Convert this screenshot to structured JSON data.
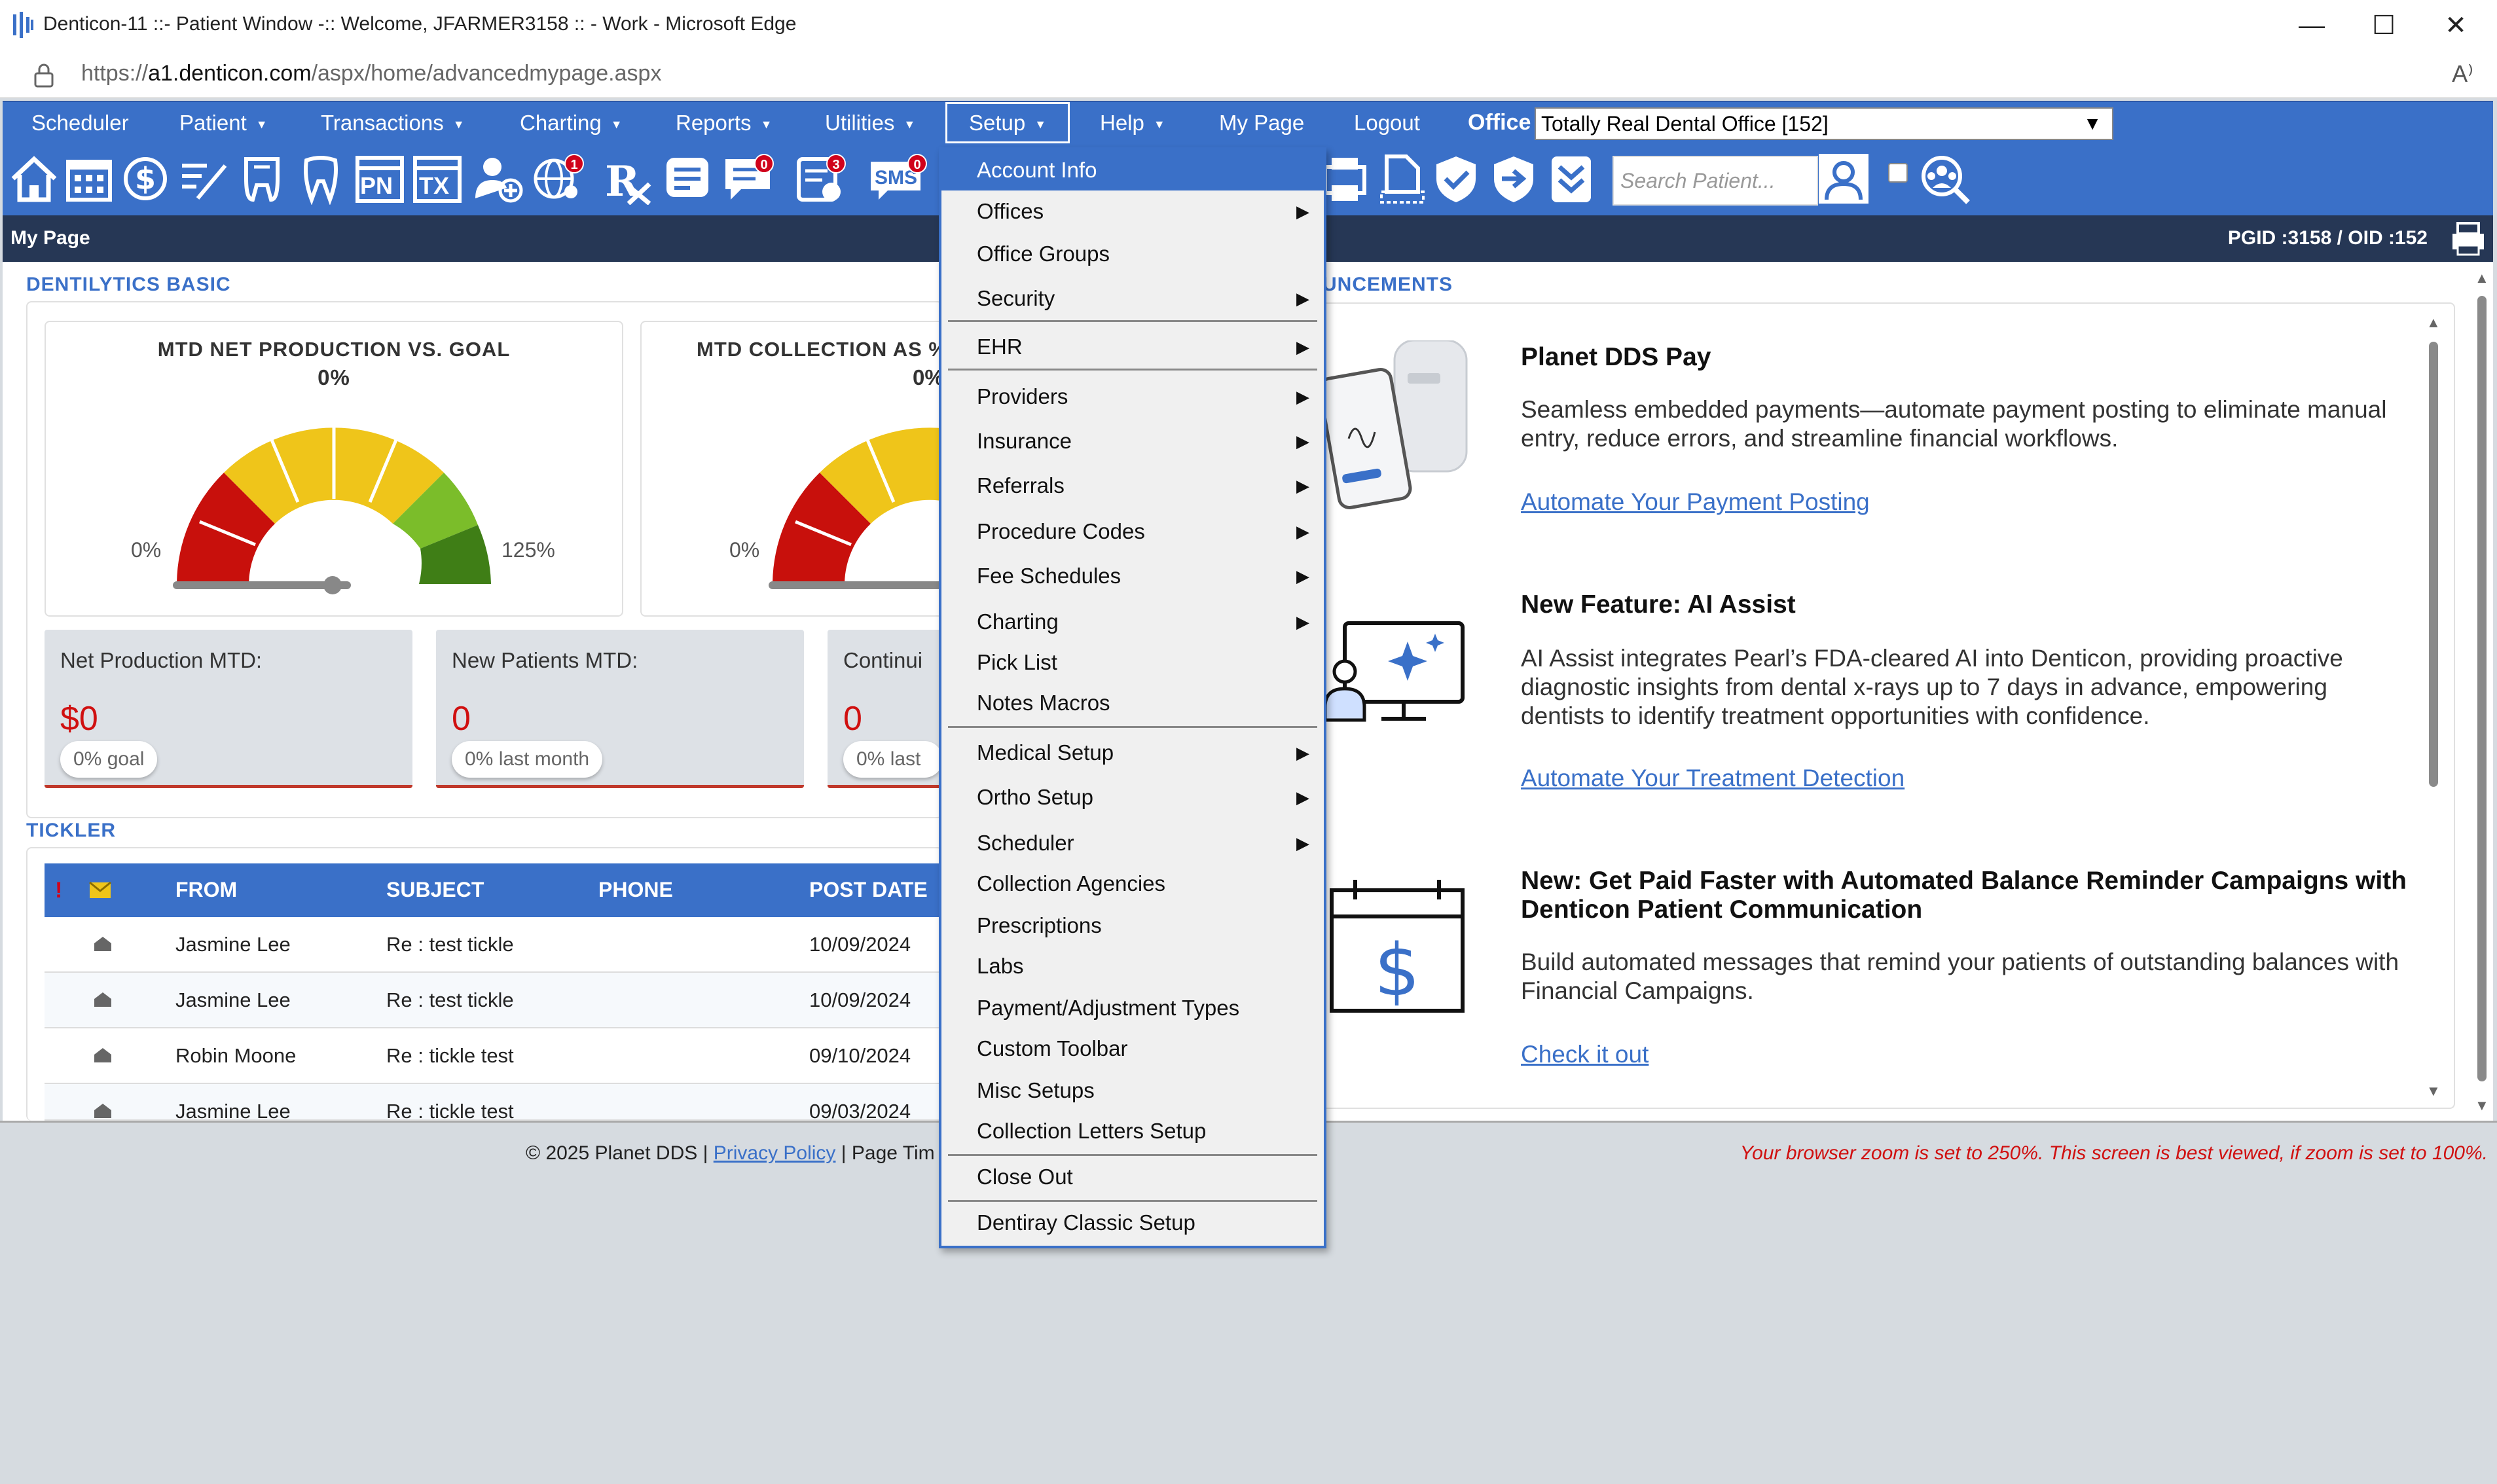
{
  "window": {
    "title": "Denticon-11 ::- Patient Window -:: Welcome, JFARMER3158 :: - Work - Microsoft Edge",
    "minimize": "—",
    "maximize": "☐",
    "close": "✕"
  },
  "address_bar": {
    "url_prefix": "https://",
    "url_host": "a1.denticon.com",
    "url_path": "/aspx/home/advancedmypage.aspx",
    "read_aloud": "A⁾"
  },
  "menu": {
    "items": [
      {
        "label": "Scheduler",
        "caret": ""
      },
      {
        "label": "Patient",
        "caret": "▼"
      },
      {
        "label": "Transactions",
        "caret": "▼"
      },
      {
        "label": "Charting",
        "caret": "▼"
      },
      {
        "label": "Reports",
        "caret": "▼"
      },
      {
        "label": "Utilities",
        "caret": "▼"
      },
      {
        "label": "Setup",
        "caret": "▼"
      },
      {
        "label": "Help",
        "caret": "▼"
      },
      {
        "label": "My Page",
        "caret": ""
      },
      {
        "label": "Logout",
        "caret": ""
      }
    ],
    "office_label": "Office",
    "office_value": "Totally Real Dental Office [152]"
  },
  "toolbar": {
    "badges": {
      "web": "1",
      "messages": "0",
      "tasks": "3",
      "sms": "0"
    },
    "sms_text": "SMS",
    "pn_text": "PN",
    "tx_text": "TX",
    "search_placeholder": "Search Patient..."
  },
  "page_bar": {
    "title": "My Page",
    "ids": "PGID :3158  /  OID :152"
  },
  "dentilytics": {
    "section_title": "DENTILYTICS BASIC",
    "gauge1": {
      "title": "MTD NET PRODUCTION VS. GOAL",
      "value": "0%",
      "min": "0%",
      "max": "125%",
      "level": 0
    },
    "gauge2": {
      "title": "MTD COLLECTION AS %",
      "value": "0%",
      "min": "0%",
      "level": 0
    },
    "kpis": [
      {
        "label": "Net Production MTD:",
        "value": "$0",
        "pill": "0% goal"
      },
      {
        "label": "New Patients MTD:",
        "value": "0",
        "pill": "0% last month"
      },
      {
        "label": "Continui",
        "value": "0",
        "pill": "0% last r"
      }
    ]
  },
  "tickler": {
    "section_title": "TICKLER",
    "flag_header": "!",
    "headers": {
      "from": "FROM",
      "subject": "SUBJECT",
      "phone": "PHONE",
      "post_date": "POST DATE"
    },
    "rows": [
      {
        "from": "Jasmine Lee",
        "subject": "Re : test tickle",
        "phone": "",
        "post_date": "10/09/2024"
      },
      {
        "from": "Jasmine Lee",
        "subject": "Re : test tickle",
        "phone": "",
        "post_date": "10/09/2024"
      },
      {
        "from": "Robin Moone",
        "subject": "Re : tickle test",
        "phone": "",
        "post_date": "09/10/2024"
      },
      {
        "from": "Jasmine Lee",
        "subject": "Re : tickle test",
        "phone": "",
        "post_date": "09/03/2024"
      }
    ]
  },
  "announcements": {
    "section_title": "UNCEMENTS",
    "items": [
      {
        "title": "Planet DDS Pay",
        "body": "Seamless embedded payments—automate payment posting to eliminate manual entry, reduce errors, and streamline financial workflows.",
        "link": "Automate Your Payment Posting"
      },
      {
        "title": "New Feature: AI Assist",
        "body": "AI Assist integrates Pearl’s FDA-cleared AI into Denticon, providing proactive diagnostic insights from dental x-rays up to 7 days in advance, empowering dentists to identify treatment opportunities with confidence.",
        "link": "Automate Your Treatment Detection"
      },
      {
        "title": "New: Get Paid Faster with Automated Balance Reminder Campaigns with Denticon Patient Communication",
        "body": "Build automated messages that remind your patients of outstanding balances with Financial Campaigns.",
        "link": "Check it out"
      }
    ]
  },
  "footer": {
    "copyright": "© 2025 Planet DDS | ",
    "privacy": "Privacy Policy",
    "page_time": " | Page Tim",
    "zoom_warning": "Your browser zoom is set to 250%. This screen is best viewed, if zoom is set to 100%."
  },
  "setup_menu": {
    "items": [
      {
        "label": "Account Info",
        "arrow": "",
        "selected": true
      },
      {
        "label": "Offices",
        "arrow": "▶"
      },
      {
        "label": "Office Groups",
        "arrow": ""
      },
      {
        "label": "Security",
        "arrow": "▶"
      },
      {
        "label": "EHR",
        "arrow": "▶"
      },
      {
        "label": "Providers",
        "arrow": "▶"
      },
      {
        "label": "Insurance",
        "arrow": "▶"
      },
      {
        "label": "Referrals",
        "arrow": "▶"
      },
      {
        "label": "Procedure Codes",
        "arrow": "▶"
      },
      {
        "label": "Fee Schedules",
        "arrow": "▶"
      },
      {
        "label": "Charting",
        "arrow": "▶"
      },
      {
        "label": "Pick List",
        "arrow": ""
      },
      {
        "label": "Notes Macros",
        "arrow": ""
      },
      {
        "label": "Medical Setup",
        "arrow": "▶"
      },
      {
        "label": "Ortho Setup",
        "arrow": "▶"
      },
      {
        "label": "Scheduler",
        "arrow": "▶"
      },
      {
        "label": "Collection Agencies",
        "arrow": ""
      },
      {
        "label": "Prescriptions",
        "arrow": ""
      },
      {
        "label": "Labs",
        "arrow": ""
      },
      {
        "label": "Payment/Adjustment Types",
        "arrow": ""
      },
      {
        "label": "Custom Toolbar",
        "arrow": ""
      },
      {
        "label": "Misc Setups",
        "arrow": ""
      },
      {
        "label": "Collection Letters Setup",
        "arrow": ""
      },
      {
        "label": "Close Out",
        "arrow": ""
      },
      {
        "label": "Dentiray Classic Setup",
        "arrow": ""
      }
    ]
  },
  "colors": {
    "brand_blue": "#3a70c8",
    "dark_bar": "#263755",
    "alert_red": "#d01010"
  }
}
